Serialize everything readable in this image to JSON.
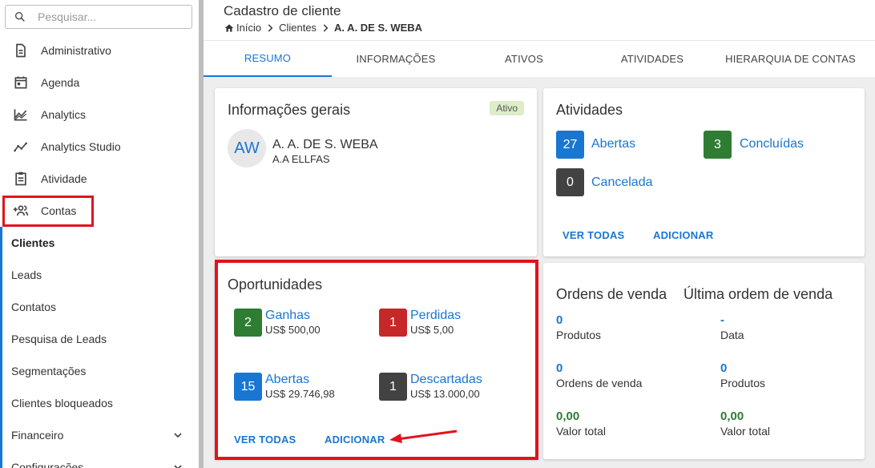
{
  "search": {
    "placeholder": "Pesquisar..."
  },
  "sidebar": {
    "items": [
      {
        "label": "Administrativo",
        "icon": "document-icon"
      },
      {
        "label": "Agenda",
        "icon": "calendar-icon"
      },
      {
        "label": "Analytics",
        "icon": "area-chart-icon"
      },
      {
        "label": "Analytics Studio",
        "icon": "trend-line-icon"
      },
      {
        "label": "Atividade",
        "icon": "clipboard-icon"
      },
      {
        "label": "Contas",
        "icon": "people-add-icon"
      }
    ],
    "subitems": [
      {
        "label": "Clientes",
        "active": true
      },
      {
        "label": "Leads"
      },
      {
        "label": "Contatos"
      },
      {
        "label": "Pesquisa de Leads"
      },
      {
        "label": "Segmentações"
      },
      {
        "label": "Clientes bloqueados"
      },
      {
        "label": "Financeiro",
        "expandable": true
      },
      {
        "label": "Configurações",
        "expandable": true
      }
    ]
  },
  "header": {
    "title": "Cadastro de cliente",
    "breadcrumb": [
      "Início",
      "Clientes",
      "A. A. DE S. WEBA"
    ]
  },
  "tabs": [
    "RESUMO",
    "INFORMAÇÕES",
    "ATIVOS",
    "ATIVIDADES",
    "HIERARQUIA DE CONTAS"
  ],
  "general_info": {
    "title": "Informações gerais",
    "status": "Ativo",
    "avatar_initials": "AW",
    "name": "A. A. DE S. WEBA",
    "subname": "A.A ELLFAS"
  },
  "activities": {
    "title": "Atividades",
    "open_count": "27",
    "open_label": "Abertas",
    "done_count": "3",
    "done_label": "Concluídas",
    "cancel_count": "0",
    "cancel_label": "Cancelada",
    "view_all": "VER TODAS",
    "add": "ADICIONAR"
  },
  "opportunities": {
    "title": "Oportunidades",
    "won_count": "2",
    "won_label": "Ganhas",
    "won_amount": "US$ 500,00",
    "lost_count": "1",
    "lost_label": "Perdidas",
    "lost_amount": "US$ 5,00",
    "open_count": "15",
    "open_label": "Abertas",
    "open_amount": "US$ 29.746,98",
    "discarded_count": "1",
    "discarded_label": "Descartadas",
    "discarded_amount": "US$ 13.000,00",
    "view_all": "VER TODAS",
    "add": "ADICIONAR"
  },
  "sales": {
    "orders_title": "Ordens de venda",
    "last_order_title": "Última ordem de venda",
    "left": [
      {
        "value": "0",
        "label": "Produtos"
      },
      {
        "value": "0",
        "label": "Ordens de venda"
      },
      {
        "value": "0,00",
        "label": "Valor total"
      }
    ],
    "right": [
      {
        "value": "-",
        "label": "Data"
      },
      {
        "value": "0",
        "label": "Produtos"
      },
      {
        "value": "0,00",
        "label": "Valor total"
      }
    ]
  },
  "colors": {
    "accent": "#1976d2",
    "success": "#2e7d32",
    "danger": "#c62828",
    "neutral": "#424242",
    "highlight": "#e0141c"
  }
}
